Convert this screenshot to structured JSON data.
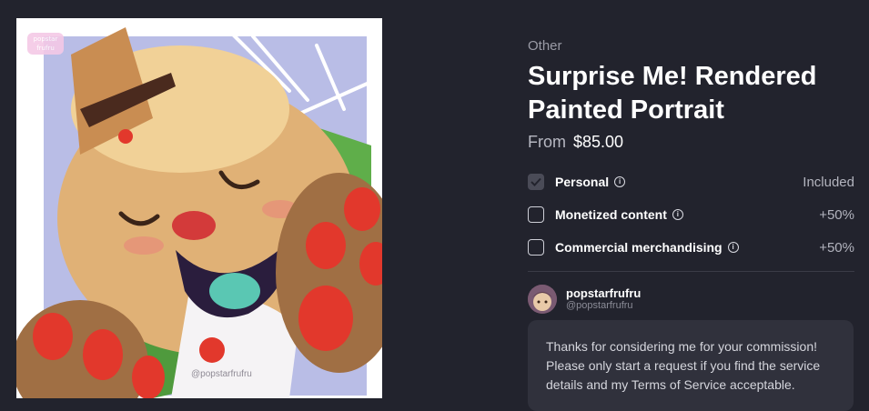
{
  "artwork": {
    "alt": "Painted portrait illustration",
    "watermark": "@popstarfrufru",
    "logo_text": "popstar frufru"
  },
  "listing": {
    "category": "Other",
    "title": "Surprise Me! Rendered Painted Portrait",
    "price_prefix": "From",
    "price": "$85.00"
  },
  "options": [
    {
      "label": "Personal",
      "price": "Included",
      "checked": true
    },
    {
      "label": "Monetized content",
      "price": "+50%",
      "checked": false
    },
    {
      "label": "Commercial merchandising",
      "price": "+50%",
      "checked": false
    }
  ],
  "artist": {
    "name": "popstarfrufru",
    "handle": "@popstarfrufru"
  },
  "message": "Thanks for considering me for your commission! Please only start a request if you find the service details and my Terms of Service acceptable.",
  "colors": {
    "background": "#22232d",
    "message_bg": "#30313c",
    "muted_text": "#9a9ba6",
    "checkbox_checked": "#4a4b57"
  },
  "icons": [
    "info-icon",
    "check-icon"
  ]
}
